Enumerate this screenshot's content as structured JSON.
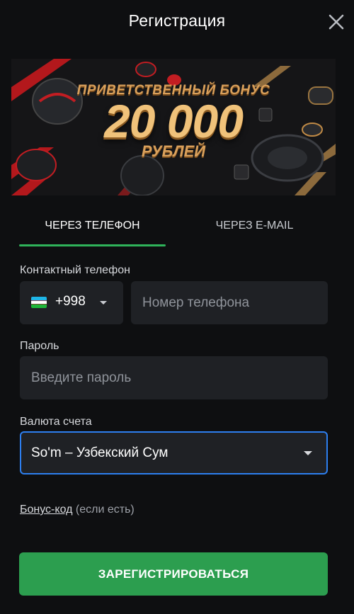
{
  "header": {
    "title": "Регистрация",
    "close_icon": "close-icon"
  },
  "banner": {
    "line1": "ПРИВЕТСТВЕННЫЙ БОНУС",
    "amount": "20 000",
    "line3": "РУБЛЕЙ"
  },
  "tabs": [
    {
      "label": "ЧЕРЕЗ ТЕЛЕФОН",
      "active": true
    },
    {
      "label": "ЧЕРЕЗ E-MAIL",
      "active": false
    }
  ],
  "form": {
    "phone_label": "Контактный телефон",
    "country_code": "+998",
    "country_flag": "uzbekistan-flag-icon",
    "phone_placeholder": "Номер телефона",
    "password_label": "Пароль",
    "password_placeholder": "Введите пароль",
    "currency_label": "Валюта счета",
    "currency_value": "So'm – Узбекский Сум",
    "bonus_link": "Бонус-код",
    "bonus_hint": " (если есть)",
    "submit_label": "ЗАРЕГИСТРИРОВАТЬСЯ"
  },
  "colors": {
    "accent_green": "#2c9e4f",
    "tab_indicator": "#2fb35a",
    "focus_blue": "#2d7ff0",
    "field_bg": "#1f2125",
    "page_bg": "#0e0f11"
  }
}
